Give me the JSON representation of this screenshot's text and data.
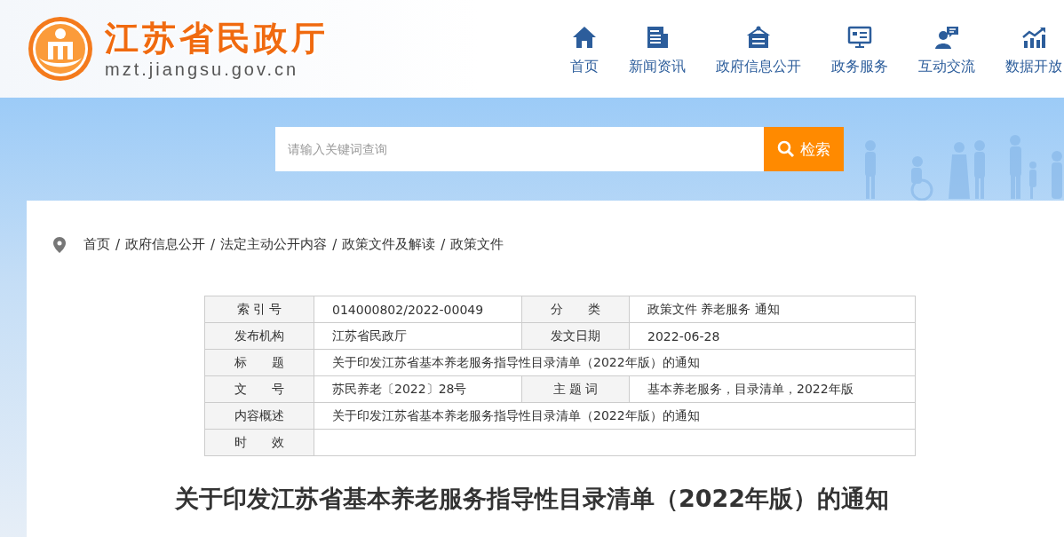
{
  "header": {
    "site_name": "江苏省民政厅",
    "url": "mzt.jiangsu.gov.cn"
  },
  "nav": [
    {
      "label": "首页"
    },
    {
      "label": "新闻资讯"
    },
    {
      "label": "政府信息公开"
    },
    {
      "label": "政务服务"
    },
    {
      "label": "互动交流"
    },
    {
      "label": "数据开放"
    }
  ],
  "search": {
    "placeholder": "请输入关键词查询",
    "button": "检索"
  },
  "breadcrumb": {
    "separator": "/",
    "items": [
      "首页",
      "政府信息公开",
      "法定主动公开内容",
      "政策文件及解读",
      "政策文件"
    ]
  },
  "info_table": [
    {
      "cells": [
        {
          "label": "索 引 号",
          "value": "014000802/2022-00049"
        },
        {
          "label": "分　　类",
          "value": "政策文件 养老服务 通知"
        }
      ]
    },
    {
      "cells": [
        {
          "label": "发布机构",
          "value": "江苏省民政厅"
        },
        {
          "label": "发文日期",
          "value": "2022-06-28"
        }
      ]
    },
    {
      "cells": [
        {
          "label": "标　　题",
          "value": "关于印发江苏省基本养老服务指导性目录清单（2022年版）的通知"
        }
      ]
    },
    {
      "cells": [
        {
          "label": "文　　号",
          "value": "苏民养老〔2022〕28号"
        },
        {
          "label": "主 题 词",
          "value": "基本养老服务，目录清单，2022年版"
        }
      ]
    },
    {
      "cells": [
        {
          "label": "内容概述",
          "value": "关于印发江苏省基本养老服务指导性目录清单（2022年版）的通知"
        }
      ]
    },
    {
      "cells": [
        {
          "label": "时　　效"
        }
      ]
    }
  ],
  "article_title": "关于印发江苏省基本养老服务指导性目录清单（2022年版）的通知"
}
